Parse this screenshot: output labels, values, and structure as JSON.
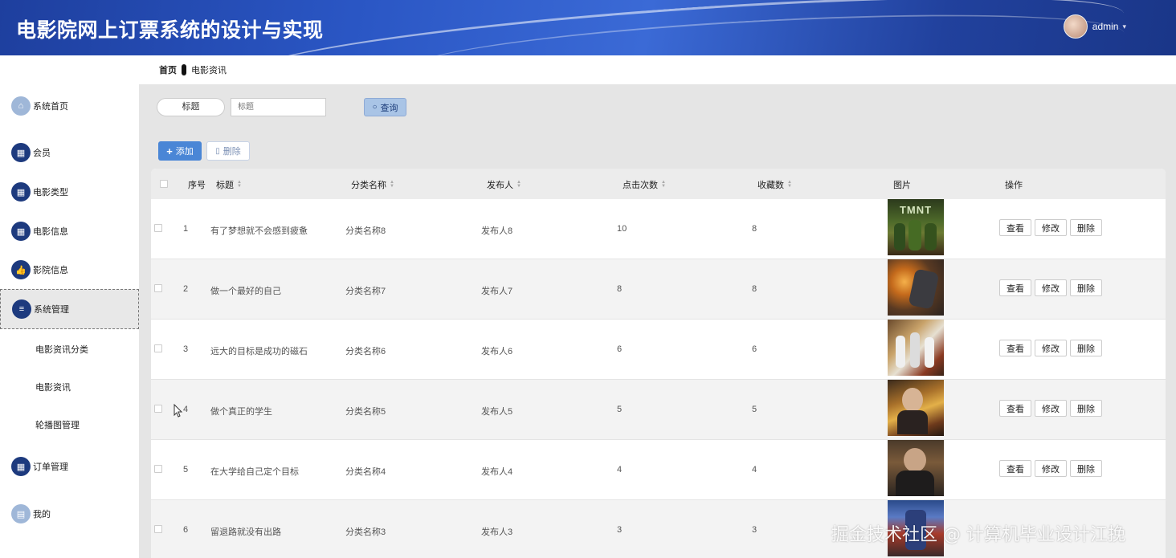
{
  "header": {
    "title": "电影院网上订票系统的设计与实现",
    "user": "admin",
    "caret": "▾"
  },
  "sidebar": {
    "items": [
      {
        "label": "系统首页",
        "icon": "home-icon",
        "glyph": "⌂"
      },
      {
        "label": "会员",
        "icon": "grid-icon",
        "glyph": "▦"
      },
      {
        "label": "电影类型",
        "icon": "grid-icon",
        "glyph": "▦"
      },
      {
        "label": "电影信息",
        "icon": "grid-icon",
        "glyph": "▦"
      },
      {
        "label": "影院信息",
        "icon": "thumbs-up-icon",
        "glyph": "👍"
      },
      {
        "label": "系统管理",
        "icon": "menu-icon",
        "glyph": "≡"
      },
      {
        "label": "订单管理",
        "icon": "grid-icon",
        "glyph": "▦"
      },
      {
        "label": "我的",
        "icon": "card-icon",
        "glyph": "▤"
      }
    ],
    "sub_items": [
      "电影资讯分类",
      "电影资讯",
      "轮播图管理"
    ]
  },
  "breadcrumb": {
    "home": "首页",
    "current": "电影资讯"
  },
  "search": {
    "label": "标题",
    "placeholder": "标题",
    "button": "查询"
  },
  "toolbar": {
    "add": "添加",
    "delete": "删除"
  },
  "table": {
    "headers": [
      "序号",
      "标题",
      "分类名称",
      "发布人",
      "点击次数",
      "收藏数",
      "图片",
      "操作"
    ],
    "rows": [
      {
        "index": "1",
        "title": "有了梦想就不会感到疲惫",
        "category": "分类名称8",
        "publisher": "发布人8",
        "clicks": "10",
        "favorites": "8",
        "image": "TMNT"
      },
      {
        "index": "2",
        "title": "做一个最好的自己",
        "category": "分类名称7",
        "publisher": "发布人7",
        "clicks": "8",
        "favorites": "8",
        "image": ""
      },
      {
        "index": "3",
        "title": "远大的目标是成功的磁石",
        "category": "分类名称6",
        "publisher": "发布人6",
        "clicks": "6",
        "favorites": "6",
        "image": ""
      },
      {
        "index": "4",
        "title": "做个真正的学生",
        "category": "分类名称5",
        "publisher": "发布人5",
        "clicks": "5",
        "favorites": "5",
        "image": ""
      },
      {
        "index": "5",
        "title": "在大学给自己定个目标",
        "category": "分类名称4",
        "publisher": "发布人4",
        "clicks": "4",
        "favorites": "4",
        "image": ""
      },
      {
        "index": "6",
        "title": "留退路就没有出路",
        "category": "分类名称3",
        "publisher": "发布人3",
        "clicks": "3",
        "favorites": "3",
        "image": ""
      }
    ],
    "ops": {
      "view": "查看",
      "edit": "修改",
      "delete": "删除"
    }
  },
  "watermark": "掘金技术社区 @ 计算机毕业设计江挽",
  "colors": {
    "header": "#2a56c4",
    "nav_icon": "#1d3a7e",
    "primary": "#4a86d6"
  }
}
